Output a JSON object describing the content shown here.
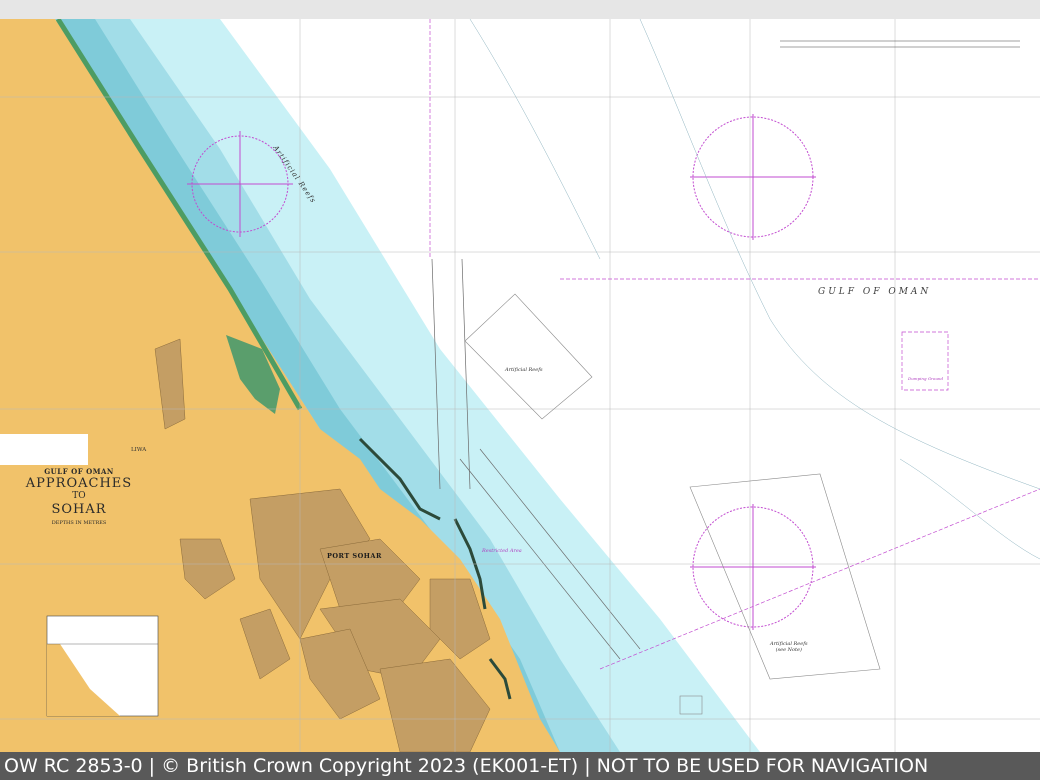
{
  "footer": {
    "text": "OW RC 2853-0 | © British Crown Copyright 2023 (EK001-ET) | NOT TO BE USED FOR NAVIGATION"
  },
  "chart_title": {
    "region": "GULF OF OMAN",
    "line1": "APPROACHES",
    "line2": "TO",
    "line3": "SOHAR",
    "subtitle": "DEPTHS IN METRES"
  },
  "labels": {
    "gulf": "GULF OF OMAN",
    "port": "PORT SOHAR",
    "liwa": "LIWA",
    "reefs_north": "Artificial Reefs",
    "reefs_south": "Artificial Reefs",
    "reefs_note": "(see Note)",
    "restricted": "Restricted Area",
    "dumping": "Dumping Ground",
    "artificial_diag": "Artificial Reefs"
  },
  "colors": {
    "land": "#f1c26a",
    "built_up": "#c6a06a",
    "shallow_blue": "#a6dfe9",
    "mid_blue": "#c9eef4",
    "deep_white": "#ffffff",
    "green_fringe": "#55a06f",
    "magenta": "#c24bd0",
    "footer_bg": "#595959"
  }
}
